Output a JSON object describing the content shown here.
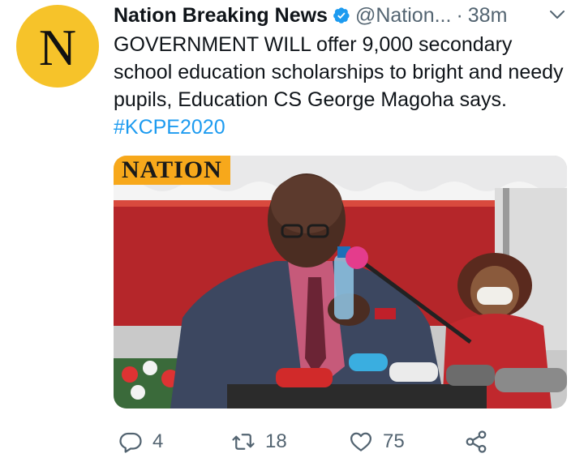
{
  "author": {
    "avatar_letter": "N",
    "avatar_color": "#f6c32a",
    "name": "Nation Breaking News",
    "verified": true,
    "handle": "@Nation...",
    "separator": "·",
    "time": "38m"
  },
  "tweet": {
    "text": "GOVERNMENT WILL offer 9,000 secondary school education scholarships to bright and needy pupils, Education CS George Magoha says.",
    "hashtag": "#KCPE2020"
  },
  "media": {
    "logo_text": "NATION",
    "description_icon": "photo-of-speaker-at-podium"
  },
  "actions": {
    "reply_count": "4",
    "retweet_count": "18",
    "like_count": "75"
  },
  "colors": {
    "link": "#1d9bf0",
    "muted": "#536471",
    "verified": "#1d9bf0"
  }
}
